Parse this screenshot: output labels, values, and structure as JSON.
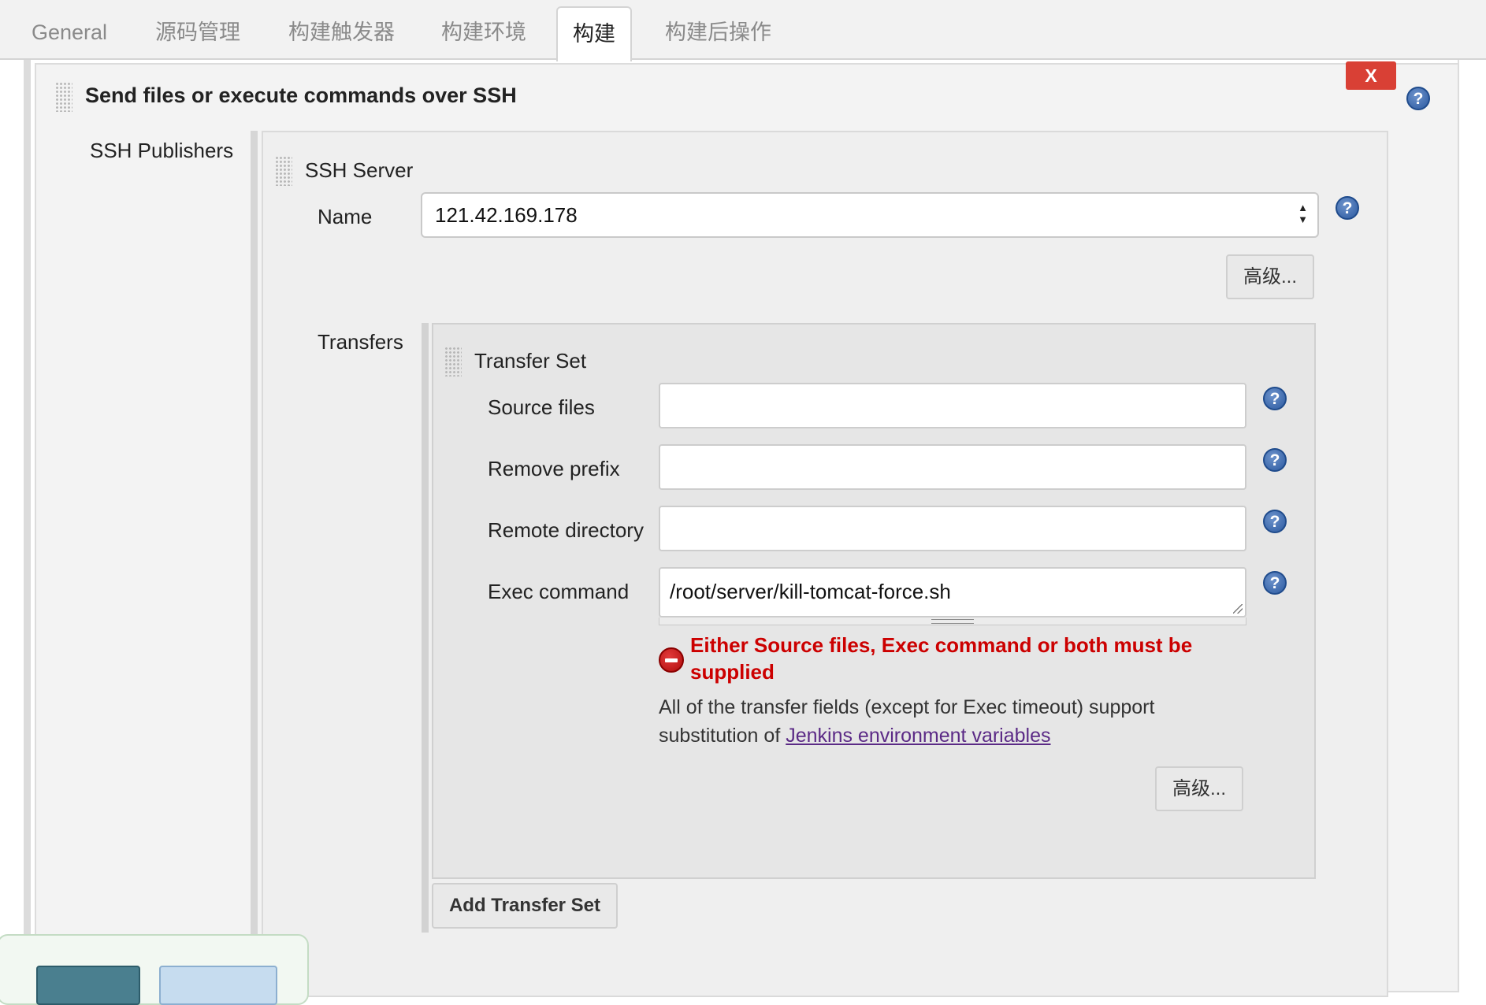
{
  "tabs": [
    {
      "label": "General"
    },
    {
      "label": "源码管理"
    },
    {
      "label": "构建触发器"
    },
    {
      "label": "构建环境"
    },
    {
      "label": "构建",
      "active": true
    },
    {
      "label": "构建后操作"
    }
  ],
  "section": {
    "title": "Send files or execute commands over SSH",
    "close_label": "X",
    "publishers_label": "SSH Publishers"
  },
  "ssh_server": {
    "title": "SSH Server",
    "name_label": "Name",
    "name_value": "121.42.169.178",
    "advanced_label": "高级..."
  },
  "transfers": {
    "label": "Transfers",
    "set_title": "Transfer Set",
    "source_files_label": "Source files",
    "source_files_value": "",
    "remove_prefix_label": "Remove prefix",
    "remove_prefix_value": "",
    "remote_directory_label": "Remote directory",
    "remote_directory_value": "",
    "exec_command_label": "Exec command",
    "exec_command_value": "/root/server/kill-tomcat-force.sh",
    "error_message": "Either Source files, Exec command or both must be supplied",
    "info_text": "All of the transfer fields (except for Exec timeout) support substitution of ",
    "info_link": "Jenkins environment variables",
    "advanced_label": "高级...",
    "add_button_label": "Add Transfer Set"
  },
  "help_icon_glyph": "?",
  "colors": {
    "close_button": "#d94035",
    "error_text": "#cc0000",
    "link": "#5b2a86",
    "save_button": "#4a7f8f",
    "apply_button": "#c6dcef"
  }
}
